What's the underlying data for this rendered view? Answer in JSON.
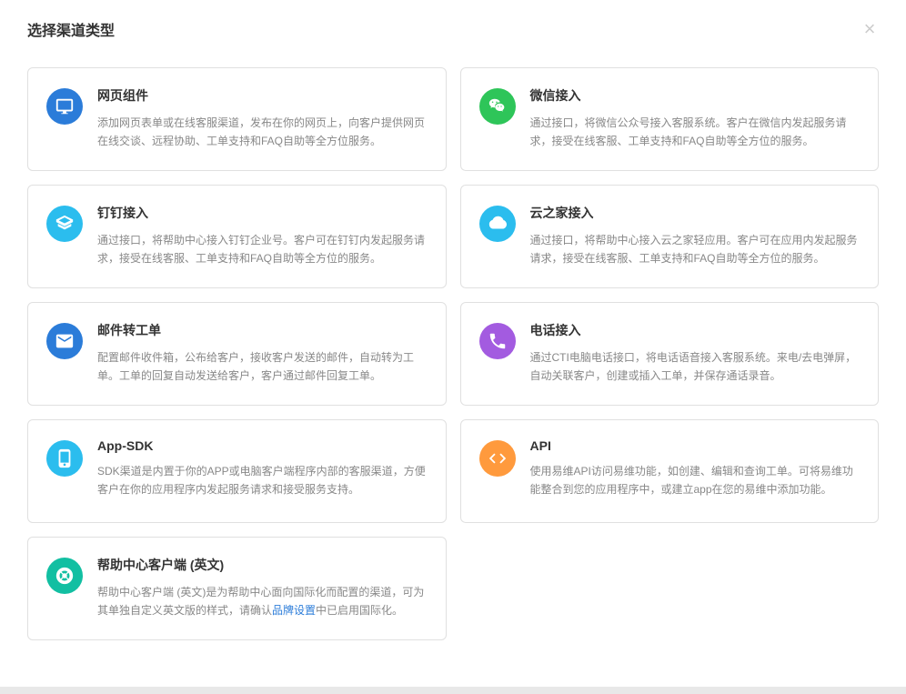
{
  "dialog": {
    "title": "选择渠道类型"
  },
  "channels": [
    {
      "title": "网页组件",
      "desc": "添加网页表单或在线客服渠道，发布在你的网页上，向客户提供网页在线交谈、远程协助、工单支持和FAQ自助等全方位服务。"
    },
    {
      "title": "微信接入",
      "desc": "通过接口，将微信公众号接入客服系统。客户在微信内发起服务请求，接受在线客服、工单支持和FAQ自助等全方位的服务。"
    },
    {
      "title": "钉钉接入",
      "desc": "通过接口，将帮助中心接入钉钉企业号。客户可在钉钉内发起服务请求，接受在线客服、工单支持和FAQ自助等全方位的服务。"
    },
    {
      "title": "云之家接入",
      "desc": "通过接口，将帮助中心接入云之家轻应用。客户可在应用内发起服务请求，接受在线客服、工单支持和FAQ自助等全方位的服务。"
    },
    {
      "title": "邮件转工单",
      "desc": "配置邮件收件箱，公布给客户，接收客户发送的邮件，自动转为工单。工单的回复自动发送给客户，客户通过邮件回复工单。"
    },
    {
      "title": "电话接入",
      "desc": "通过CTI电脑电话接口，将电话语音接入客服系统。来电/去电弹屏，自动关联客户，创建或插入工单，并保存通话录音。"
    },
    {
      "title": "App-SDK",
      "desc": "SDK渠道是内置于你的APP或电脑客户端程序内部的客服渠道，方便客户在你的应用程序内发起服务请求和接受服务支持。"
    },
    {
      "title": "API",
      "desc": "使用易维API访问易维功能，如创建、编辑和查询工单。可将易维功能整合到您的应用程序中，或建立app在您的易维中添加功能。"
    },
    {
      "title": "帮助中心客户端 (英文)",
      "descPrefix": "帮助中心客户端 (英文)是为帮助中心面向国际化而配置的渠道，可为其单独自定义英文版的样式，请确认",
      "linkText": "品牌设置",
      "descSuffix": "中已启用国际化。"
    }
  ]
}
